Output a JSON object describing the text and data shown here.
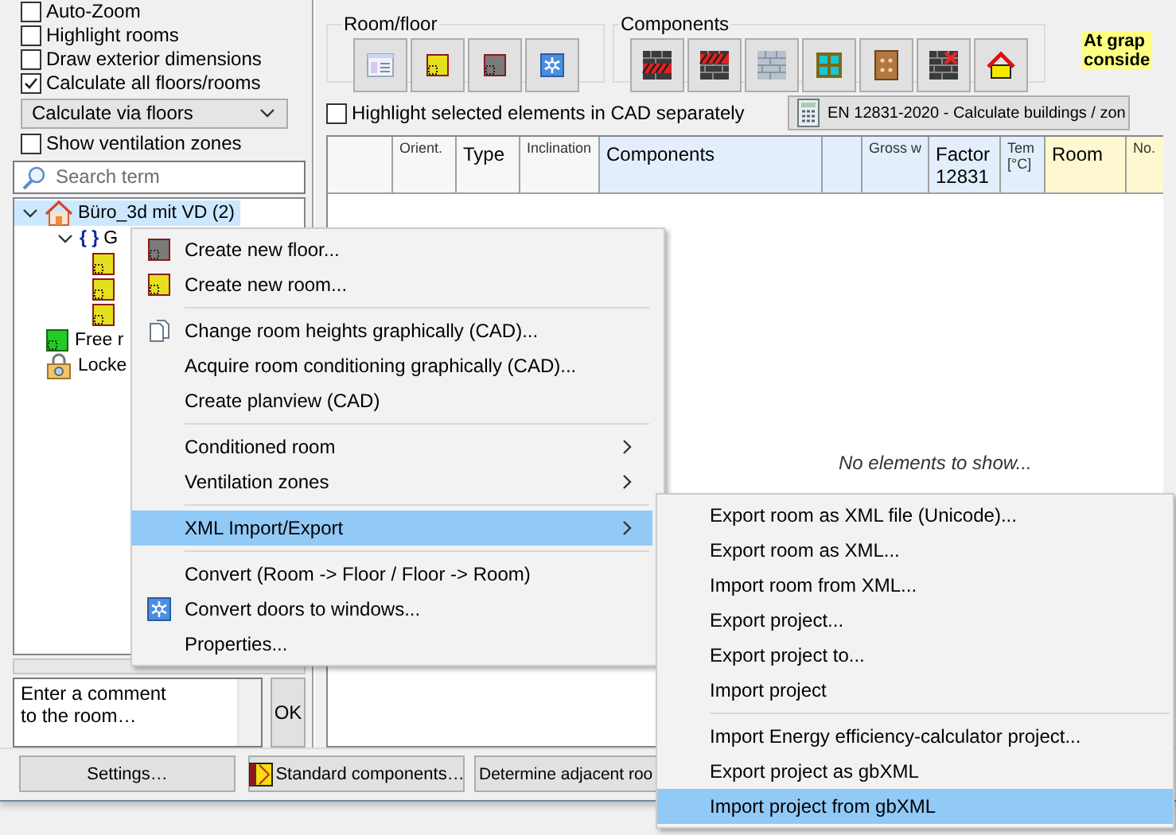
{
  "options": [
    {
      "label": "Auto-Zoom",
      "checked": false
    },
    {
      "label": "Highlight rooms",
      "checked": false
    },
    {
      "label": "Draw exterior dimensions",
      "checked": false
    },
    {
      "label": "Calculate all floors/rooms",
      "checked": true
    }
  ],
  "calc_mode": {
    "value": "Calculate via floors"
  },
  "show_zones": {
    "label": "Show ventilation zones",
    "checked": false
  },
  "search": {
    "placeholder": "Search term"
  },
  "tree": [
    {
      "label": "Büro_3d mit VD (2)",
      "kind": "building",
      "selected": true,
      "expanded": true,
      "children": [
        {
          "label": "G",
          "symbol": "{ }",
          "kind": "floor",
          "selected": false,
          "expanded": true,
          "children": [
            {
              "kind": "room",
              "selected": false
            },
            {
              "kind": "room",
              "selected": false
            },
            {
              "kind": "room",
              "selected": false
            }
          ]
        }
      ]
    },
    {
      "label": "Free r",
      "kind": "free",
      "selected": false
    },
    {
      "label": "Locke",
      "kind": "locked",
      "selected": false
    }
  ],
  "comment": {
    "value": "Enter a comment\nto the room…"
  },
  "ok_button": {
    "label": "OK"
  },
  "bottom_buttons": [
    {
      "label": "Settings…"
    },
    {
      "label": "Standard components…"
    },
    {
      "label": "Determine adjacent roo"
    }
  ],
  "ribbon": [
    {
      "title": "Room/floor",
      "buttons": [
        {
          "kind": "form"
        },
        {
          "kind": "room"
        },
        {
          "kind": "floor"
        },
        {
          "kind": "snow"
        }
      ]
    },
    {
      "title": "Components",
      "buttons": [
        {
          "kind": "wall_top"
        },
        {
          "kind": "wall_bottom"
        },
        {
          "kind": "wall_grey"
        },
        {
          "kind": "window"
        },
        {
          "kind": "door"
        },
        {
          "kind": "wall_x"
        },
        {
          "kind": "roof"
        }
      ]
    }
  ],
  "note": {
    "lines": [
      "At grap",
      "conside"
    ]
  },
  "highlight_cad": {
    "label": "Highlight selected elements in CAD separately",
    "checked": false
  },
  "calc_button": {
    "label": "EN 12831-2020 - Calculate buildings / zon"
  },
  "table": {
    "columns": [
      {
        "color": "#f7f7f7"
      },
      {
        "label": "Orient.",
        "kind": "small",
        "color": "#f7f7f7"
      },
      {
        "label": "Type",
        "kind": "normal",
        "color": "#f7f7f7"
      },
      {
        "label": "Inclination",
        "kind": "small",
        "color": "#f7f7f7"
      },
      {
        "label": "Components",
        "kind": "normal",
        "color": "#e3eefc"
      },
      {
        "color": "#e3eefc"
      },
      {
        "label": "Gross w",
        "kind": "small",
        "color": "#e3eefc"
      },
      {
        "label": "Factor 12831",
        "kind": "normal",
        "color": "#e3eefc"
      },
      {
        "label": "Tem [°C]",
        "kind": "small",
        "color": "#e3eefc"
      },
      {
        "label": "Room",
        "kind": "normal",
        "color": "#fdf8d0"
      },
      {
        "label": "No.",
        "kind": "small",
        "color": "#fdf8d0"
      }
    ],
    "empty_message": "No elements to show..."
  },
  "context_menu": {
    "items": [
      {
        "kind": "item",
        "label": "Create new floor...",
        "submenu": false,
        "selected": false
      },
      {
        "kind": "item",
        "label": "Create new room...",
        "submenu": false,
        "selected": false
      },
      {
        "kind": "separator"
      },
      {
        "kind": "item",
        "label": "Change room heights graphically (CAD)...",
        "submenu": false,
        "selected": false
      },
      {
        "kind": "item",
        "label": "Acquire room conditioning graphically (CAD)...",
        "submenu": false,
        "selected": false
      },
      {
        "kind": "item",
        "label": "Create planview (CAD)",
        "submenu": false,
        "selected": false
      },
      {
        "kind": "separator"
      },
      {
        "kind": "item",
        "label": "Conditioned room",
        "submenu": true,
        "selected": false
      },
      {
        "kind": "item",
        "label": "Ventilation zones",
        "submenu": true,
        "selected": false
      },
      {
        "kind": "separator"
      },
      {
        "kind": "item",
        "label": "XML Import/Export",
        "submenu": true,
        "selected": true
      },
      {
        "kind": "separator"
      },
      {
        "kind": "item",
        "label": "Convert (Room -> Floor / Floor -> Room)",
        "submenu": false,
        "selected": false
      },
      {
        "kind": "item",
        "label": "Convert doors to windows...",
        "submenu": false,
        "selected": false
      },
      {
        "kind": "item",
        "label": "Properties...",
        "submenu": false,
        "selected": false
      }
    ]
  },
  "submenu": {
    "items": [
      {
        "kind": "item",
        "label": "Export room as XML file (Unicode)...",
        "submenu": false,
        "selected": false
      },
      {
        "kind": "item",
        "label": "Export room as XML...",
        "submenu": false,
        "selected": false
      },
      {
        "kind": "item",
        "label": "Import room from XML...",
        "submenu": false,
        "selected": false
      },
      {
        "kind": "item",
        "label": "Export project...",
        "submenu": false,
        "selected": false
      },
      {
        "kind": "item",
        "label": "Export project to...",
        "submenu": false,
        "selected": false
      },
      {
        "kind": "item",
        "label": "Import project",
        "submenu": false,
        "selected": false
      },
      {
        "kind": "separator"
      },
      {
        "kind": "item",
        "label": "Import Energy efficiency-calculator project...",
        "submenu": false,
        "selected": false
      },
      {
        "kind": "item",
        "label": "Export project as gbXML",
        "submenu": false,
        "selected": false
      },
      {
        "kind": "item",
        "label": "Import project from gbXML",
        "submenu": false,
        "selected": true
      }
    ]
  }
}
